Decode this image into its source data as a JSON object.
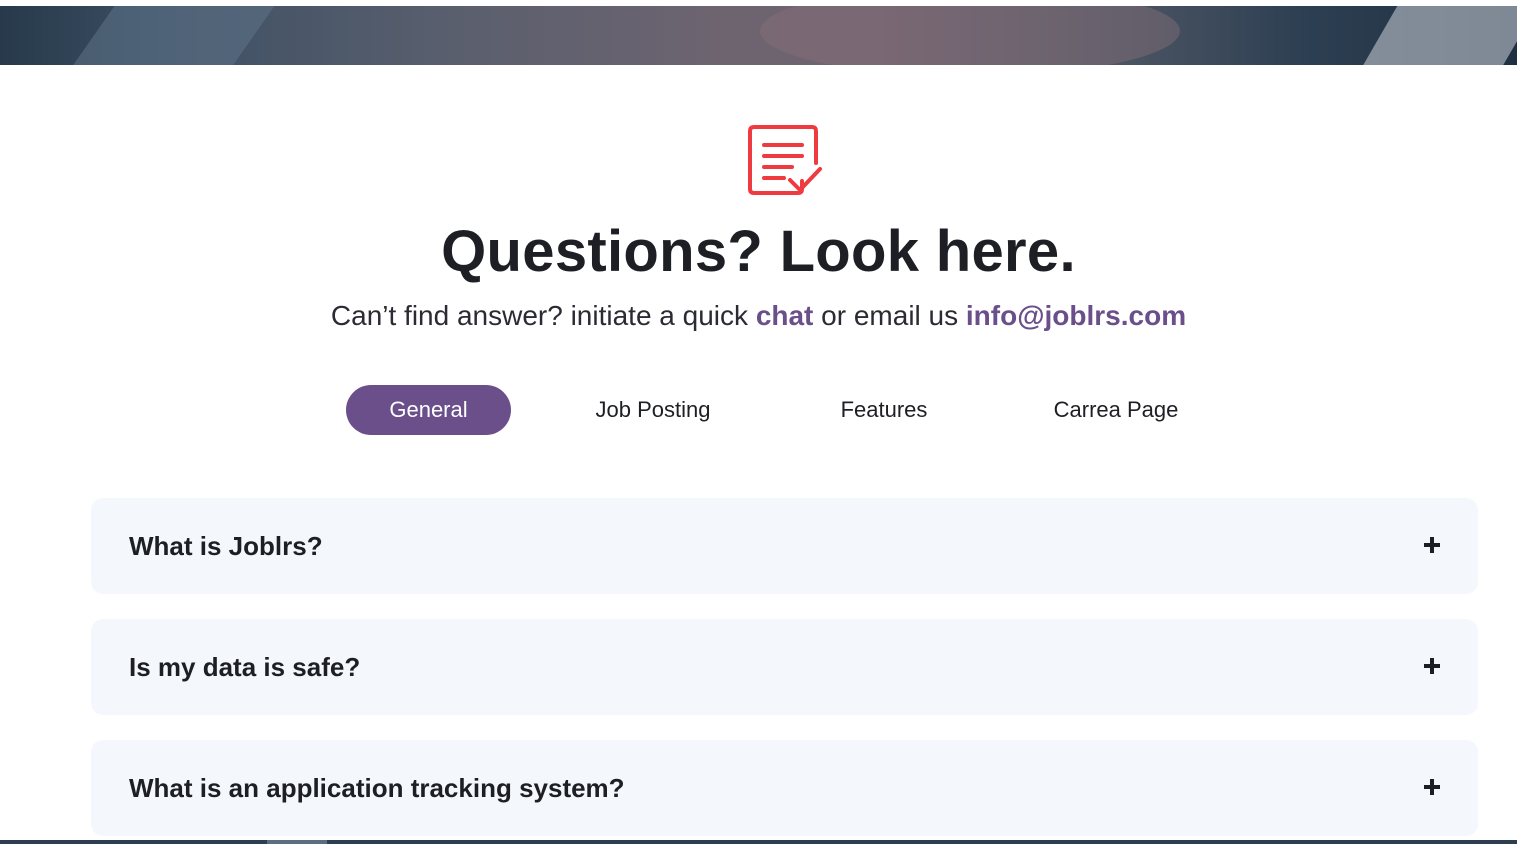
{
  "colors": {
    "accent": "#6a4f8b",
    "icon": "#ef3b3f",
    "card_background": "#f4f8fd",
    "heading": "#1e1f24"
  },
  "hero": {
    "icon": "document-check-icon",
    "title": "Questions? Look here.",
    "subtitle_prefix": "Can’t find answer? initiate a quick",
    "chat_link": "chat",
    "subtitle_middle": "or email us",
    "email_link": "info@joblrs.com"
  },
  "tabs": [
    {
      "label": "General",
      "active": true
    },
    {
      "label": "Job Posting",
      "active": false
    },
    {
      "label": "Features",
      "active": false
    },
    {
      "label": "Carrea Page",
      "active": false
    }
  ],
  "faq": [
    {
      "question": "What is Joblrs?",
      "toggle_icon": "plus-icon"
    },
    {
      "question": "Is my data is safe?",
      "toggle_icon": "plus-icon"
    },
    {
      "question": "What is an application tracking system?",
      "toggle_icon": "plus-icon"
    }
  ]
}
